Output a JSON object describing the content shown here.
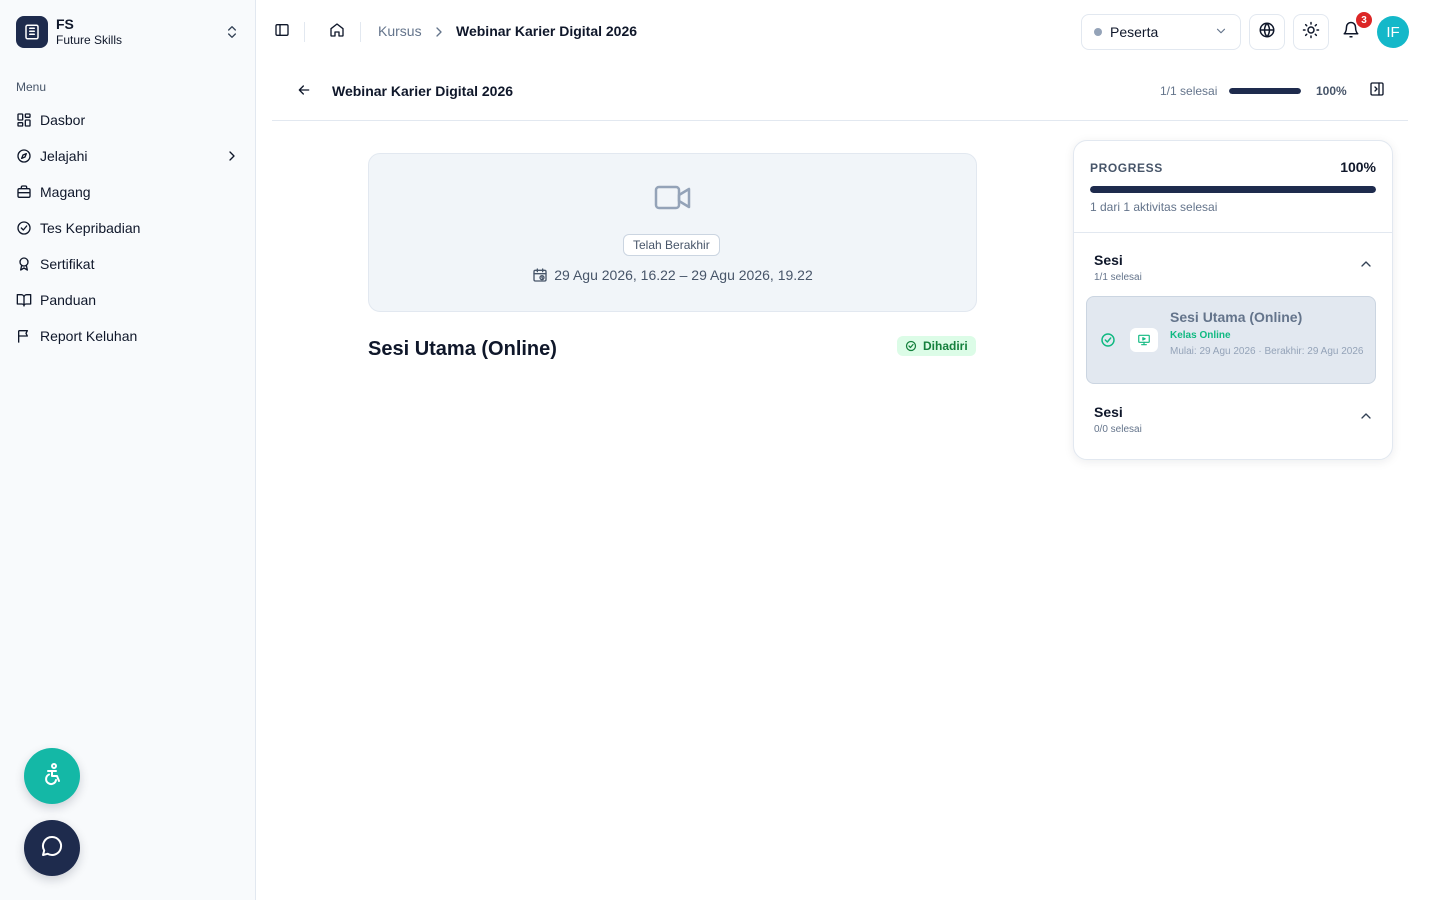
{
  "org": {
    "short": "FS",
    "name": "Future Skills"
  },
  "sidebar": {
    "menu_title": "Menu",
    "items": [
      {
        "label": "Dasbor",
        "icon": "dashboard-icon"
      },
      {
        "label": "Jelajahi",
        "icon": "compass-icon",
        "has_submenu": true
      },
      {
        "label": "Magang",
        "icon": "briefcase-icon"
      },
      {
        "label": "Tes Kepribadian",
        "icon": "check-circle-icon"
      },
      {
        "label": "Sertifikat",
        "icon": "award-icon"
      },
      {
        "label": "Panduan",
        "icon": "book-open-icon"
      },
      {
        "label": "Report Keluhan",
        "icon": "flag-icon"
      }
    ]
  },
  "topbar": {
    "breadcrumb": {
      "parent": "Kursus",
      "current": "Webinar Karier Digital 2026"
    },
    "role": "Peserta",
    "notifications_count": "3",
    "avatar_initials": "IF"
  },
  "course": {
    "title": "Webinar Karier Digital 2026",
    "completed_text": "1/1 selesai",
    "progress_text": "100%",
    "progress_fraction": 1.0
  },
  "video": {
    "status": "Telah Berakhir",
    "schedule": "29 Agu 2026, 16.22 – 29 Agu 2026, 19.22"
  },
  "session": {
    "title": "Sesi Utama (Online)",
    "attendance": "Dihadiri"
  },
  "progress_panel": {
    "label": "PROGRESS",
    "percent": "100%",
    "fraction": 1.0,
    "summary": "1 dari 1 aktivitas selesai",
    "sections": [
      {
        "title": "Sesi",
        "subtitle": "1/1 selesai",
        "activities": [
          {
            "title": "Sesi Utama (Online)",
            "kind": "Kelas Online",
            "time": "Mulai: 29 Agu 2026 · Berakhir: 29 Agu 2026",
            "completed": true
          }
        ]
      },
      {
        "title": "Sesi",
        "subtitle": "0/0 selesai",
        "activities": []
      }
    ]
  },
  "colors": {
    "brand_navy": "#1e2b4d",
    "accent_teal": "#14b8a6",
    "success": "#10b981",
    "badge_red": "#dc2626"
  }
}
